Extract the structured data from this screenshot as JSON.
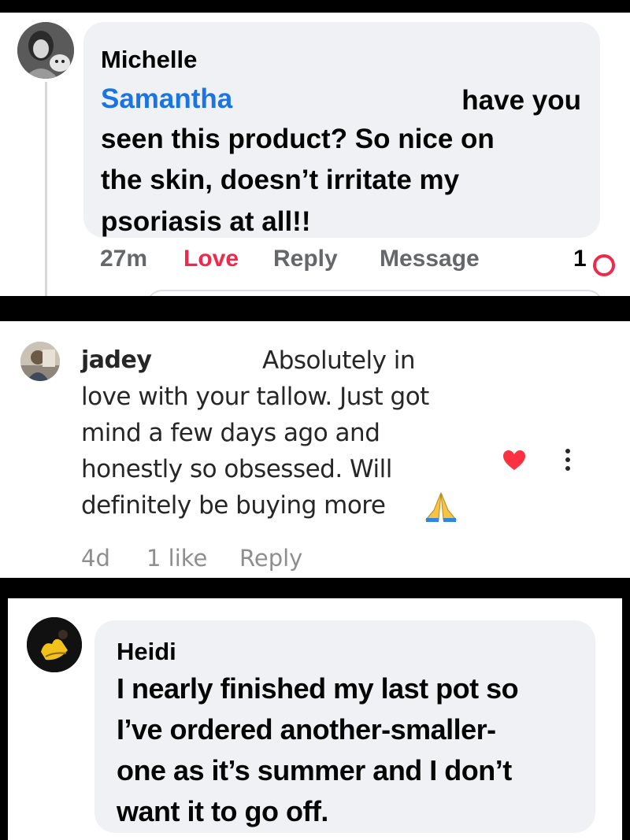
{
  "comment1": {
    "author": "Michelle",
    "mention": "Samantha",
    "lines": [
      "have you",
      "seen this product? So nice on",
      "the skin, doesn’t irritate my",
      "psoriasis at all!!"
    ],
    "time": "27m",
    "love_label": "Love",
    "reply_label": "Reply",
    "message_label": "Message",
    "reaction_count": "1",
    "reaction_icon": "heart-reaction-icon",
    "colors": {
      "mention": "#1b74e4",
      "love": "#f02849",
      "bubble": "#eff1f5"
    }
  },
  "comment2": {
    "author": "jadey",
    "lines": [
      "Absolutely in",
      "love with your tallow. Just got",
      "mind a few days ago and",
      "honestly so obsessed. Will",
      "definitely be buying more"
    ],
    "emoji": "folded-hands-icon",
    "time": "4d",
    "likes": "1 like",
    "reply_label": "Reply",
    "like_icon": "heart-icon",
    "menu_icon": "more-options-icon",
    "colors": {
      "heart": "#ff3040"
    }
  },
  "comment3": {
    "author": "Heidi",
    "lines": [
      "I nearly finished my last pot so",
      "I’ve ordered another-smaller-",
      "one as it’s summer and I don’t",
      "want it to go off."
    ],
    "colors": {
      "bubble": "#eff1f5"
    }
  }
}
